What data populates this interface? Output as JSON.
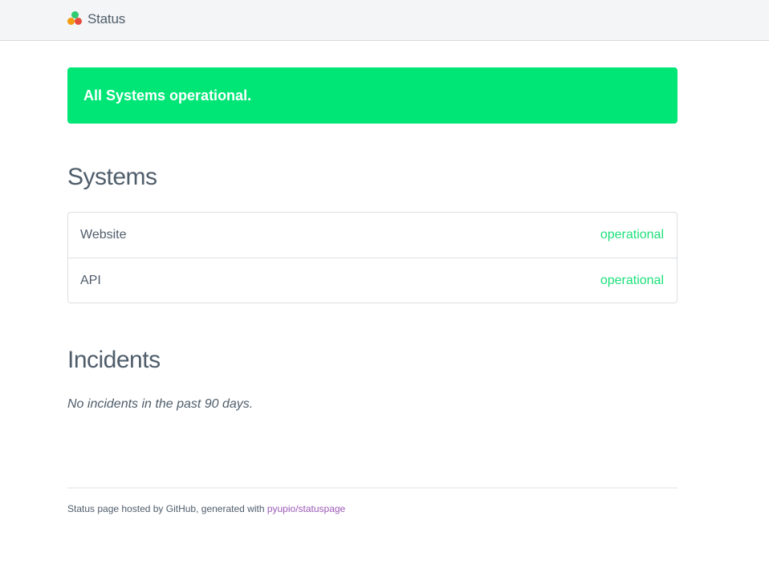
{
  "header": {
    "brand_label": "Status",
    "logo_colors": {
      "top": "#2ecc71",
      "left": "#f39c12",
      "right": "#e74c3c"
    }
  },
  "banner": {
    "message": "All Systems operational.",
    "color": "#00e676"
  },
  "systems": {
    "title": "Systems",
    "items": [
      {
        "name": "Website",
        "status": "operational"
      },
      {
        "name": "API",
        "status": "operational"
      }
    ],
    "status_color": "#1ce07a"
  },
  "incidents": {
    "title": "Incidents",
    "empty_message": "No incidents in the past 90 days."
  },
  "footer": {
    "text": "Status page hosted by GitHub, generated with ",
    "link_text": "pyupio/statuspage",
    "link_color": "#9b59b6"
  }
}
